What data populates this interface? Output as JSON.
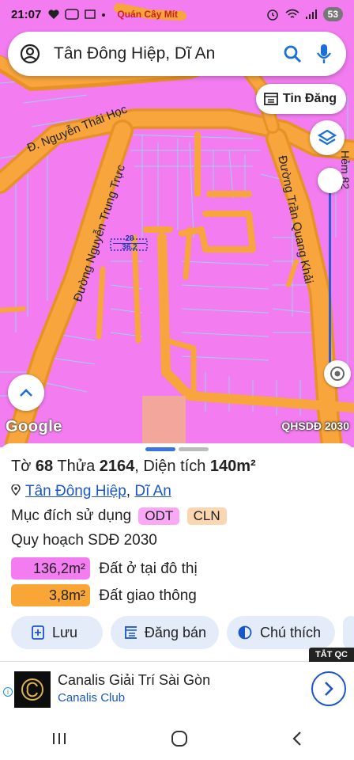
{
  "status_bar": {
    "time": "21:07",
    "battery": "53",
    "poi_label": "Quán Cây Mít"
  },
  "search": {
    "query": "Tân Đông Hiệp, Dĩ An"
  },
  "map": {
    "tin_dang_label": "Tin Đăng",
    "streets": {
      "nguyen_thai_hoc": "Đ. Nguyễn Thái Học",
      "nguyen_trung_truc": "Đường Nguyễn Trung Trực",
      "tran_quang_khai": "Đường Trần Quang Khải",
      "hem": "Hẻm 82"
    },
    "plot_label_top": "29",
    "plot_label_bottom": "36.2",
    "google_label": "Google",
    "plan_label": "QHSDĐ 2030"
  },
  "parcel": {
    "to_label": "Tờ",
    "to": "68",
    "thua_label": "Thửa",
    "thua": "2164",
    "area_label": ", Diện tích",
    "area": "140m²",
    "ward": "Tân Đông Hiệp",
    "district": "Dĩ An",
    "purpose_label": "Mục đích sử dụng",
    "purpose_tags": [
      "ODT",
      "CLN"
    ],
    "plan_heading": "Quy hoạch SDĐ 2030",
    "zones": [
      {
        "area": "136,2m²",
        "label": "Đất ở tại đô thị",
        "color": "#f27cf0"
      },
      {
        "area": "3,8m²",
        "label": "Đất giao thông",
        "color": "#f9a636"
      }
    ]
  },
  "actions": {
    "save": "Lưu",
    "post": "Đăng bán",
    "legend": "Chú thích"
  },
  "ad": {
    "close_label": "TẮT QC",
    "title": "Canalis Giải Trí Sài Gòn",
    "subtitle": "Canalis Club"
  }
}
